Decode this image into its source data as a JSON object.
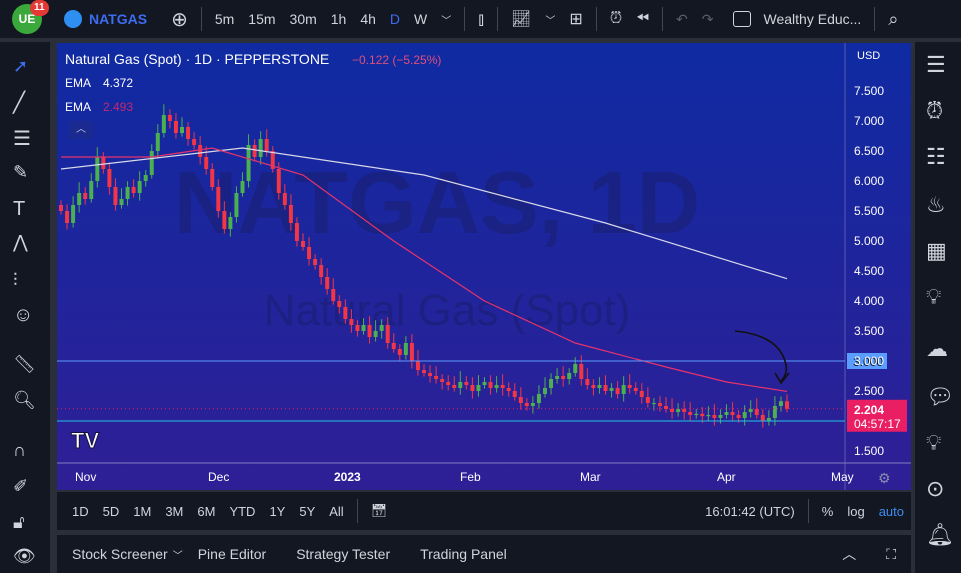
{
  "topbar": {
    "badge": "11",
    "symbol": "NATGAS",
    "intervals": [
      "5m",
      "15m",
      "30m",
      "1h",
      "4h",
      "D",
      "W"
    ],
    "active_interval": "D",
    "workspace": "Wealthy Educ..."
  },
  "legend": {
    "title": "Natural Gas (Spot) · 1D · PEPPERSTONE",
    "change": "−0.122 (−5.25%)",
    "ema1_label": "EMA",
    "ema1_value": "4.372",
    "ema2_label": "EMA",
    "ema2_value": "2.493"
  },
  "watermark": {
    "line1": "NATGAS, 1D",
    "line2": "Natural Gas (Spot)"
  },
  "currency": "USD",
  "colors": {
    "up": "#4caf50",
    "down": "#f23645",
    "ema_slow": "#d8d8e8",
    "ema_fast": "#e8336a",
    "line3": "#5b9cff",
    "line2": "#22c4e0",
    "price": "#e91e63"
  },
  "chart_data": {
    "type": "candlestick",
    "yticks": [
      "7.500",
      "7.000",
      "6.500",
      "6.000",
      "5.500",
      "5.000",
      "4.500",
      "4.000",
      "3.500",
      "3.000",
      "2.500",
      "1.500"
    ],
    "ylim": [
      1.5,
      7.5
    ],
    "xticks": [
      "Nov",
      "Dec",
      "2023",
      "Feb",
      "Mar",
      "Apr",
      "May"
    ],
    "closes": [
      5.5,
      5.3,
      5.6,
      5.8,
      5.7,
      6.0,
      6.4,
      6.2,
      5.9,
      5.6,
      5.7,
      5.9,
      5.8,
      6.0,
      6.1,
      6.5,
      6.8,
      7.1,
      7.0,
      6.8,
      6.9,
      6.7,
      6.6,
      6.4,
      6.2,
      5.9,
      5.5,
      5.2,
      5.4,
      5.8,
      6.0,
      6.6,
      6.4,
      6.7,
      6.5,
      6.2,
      5.8,
      5.6,
      5.3,
      5.0,
      4.9,
      4.7,
      4.6,
      4.4,
      4.2,
      4.0,
      3.9,
      3.7,
      3.6,
      3.5,
      3.6,
      3.4,
      3.5,
      3.6,
      3.3,
      3.2,
      3.1,
      3.3,
      3.0,
      2.85,
      2.8,
      2.75,
      2.7,
      2.65,
      2.6,
      2.55,
      2.65,
      2.6,
      2.5,
      2.6,
      2.65,
      2.55,
      2.6,
      2.55,
      2.5,
      2.4,
      2.3,
      2.25,
      2.3,
      2.45,
      2.55,
      2.7,
      2.75,
      2.7,
      2.8,
      2.95,
      2.7,
      2.6,
      2.55,
      2.6,
      2.5,
      2.55,
      2.45,
      2.6,
      2.55,
      2.5,
      2.4,
      2.3,
      2.3,
      2.25,
      2.2,
      2.15,
      2.2,
      2.15,
      2.1,
      2.12,
      2.08,
      2.1,
      2.05,
      2.1,
      2.15,
      2.1,
      2.05,
      2.15,
      2.2,
      2.1,
      2.0,
      2.05,
      2.25,
      2.33,
      2.204
    ],
    "ema_slow": [
      [
        0,
        6.2
      ],
      [
        30,
        6.55
      ],
      [
        60,
        6.1
      ],
      [
        90,
        5.3
      ],
      [
        120,
        4.372
      ]
    ],
    "ema_fast": [
      [
        0,
        6.4
      ],
      [
        15,
        6.4
      ],
      [
        25,
        6.55
      ],
      [
        40,
        6.1
      ],
      [
        55,
        5.0
      ],
      [
        70,
        4.0
      ],
      [
        85,
        3.3
      ],
      [
        100,
        2.9
      ],
      [
        110,
        2.65
      ],
      [
        120,
        2.493
      ]
    ],
    "hlines": [
      {
        "value": 3.0,
        "label": "3.000"
      },
      {
        "value": 2.0,
        "label": "2.000"
      }
    ],
    "last_price": "2.204",
    "countdown": "04:57:17"
  },
  "ranges": [
    "1D",
    "5D",
    "1M",
    "3M",
    "6M",
    "YTD",
    "1Y",
    "5Y",
    "All"
  ],
  "status": {
    "time": "16:01:42 (UTC)",
    "percent": "%",
    "log": "log",
    "auto": "auto"
  },
  "panels": [
    "Stock Screener",
    "Pine Editor",
    "Strategy Tester",
    "Trading Panel"
  ]
}
